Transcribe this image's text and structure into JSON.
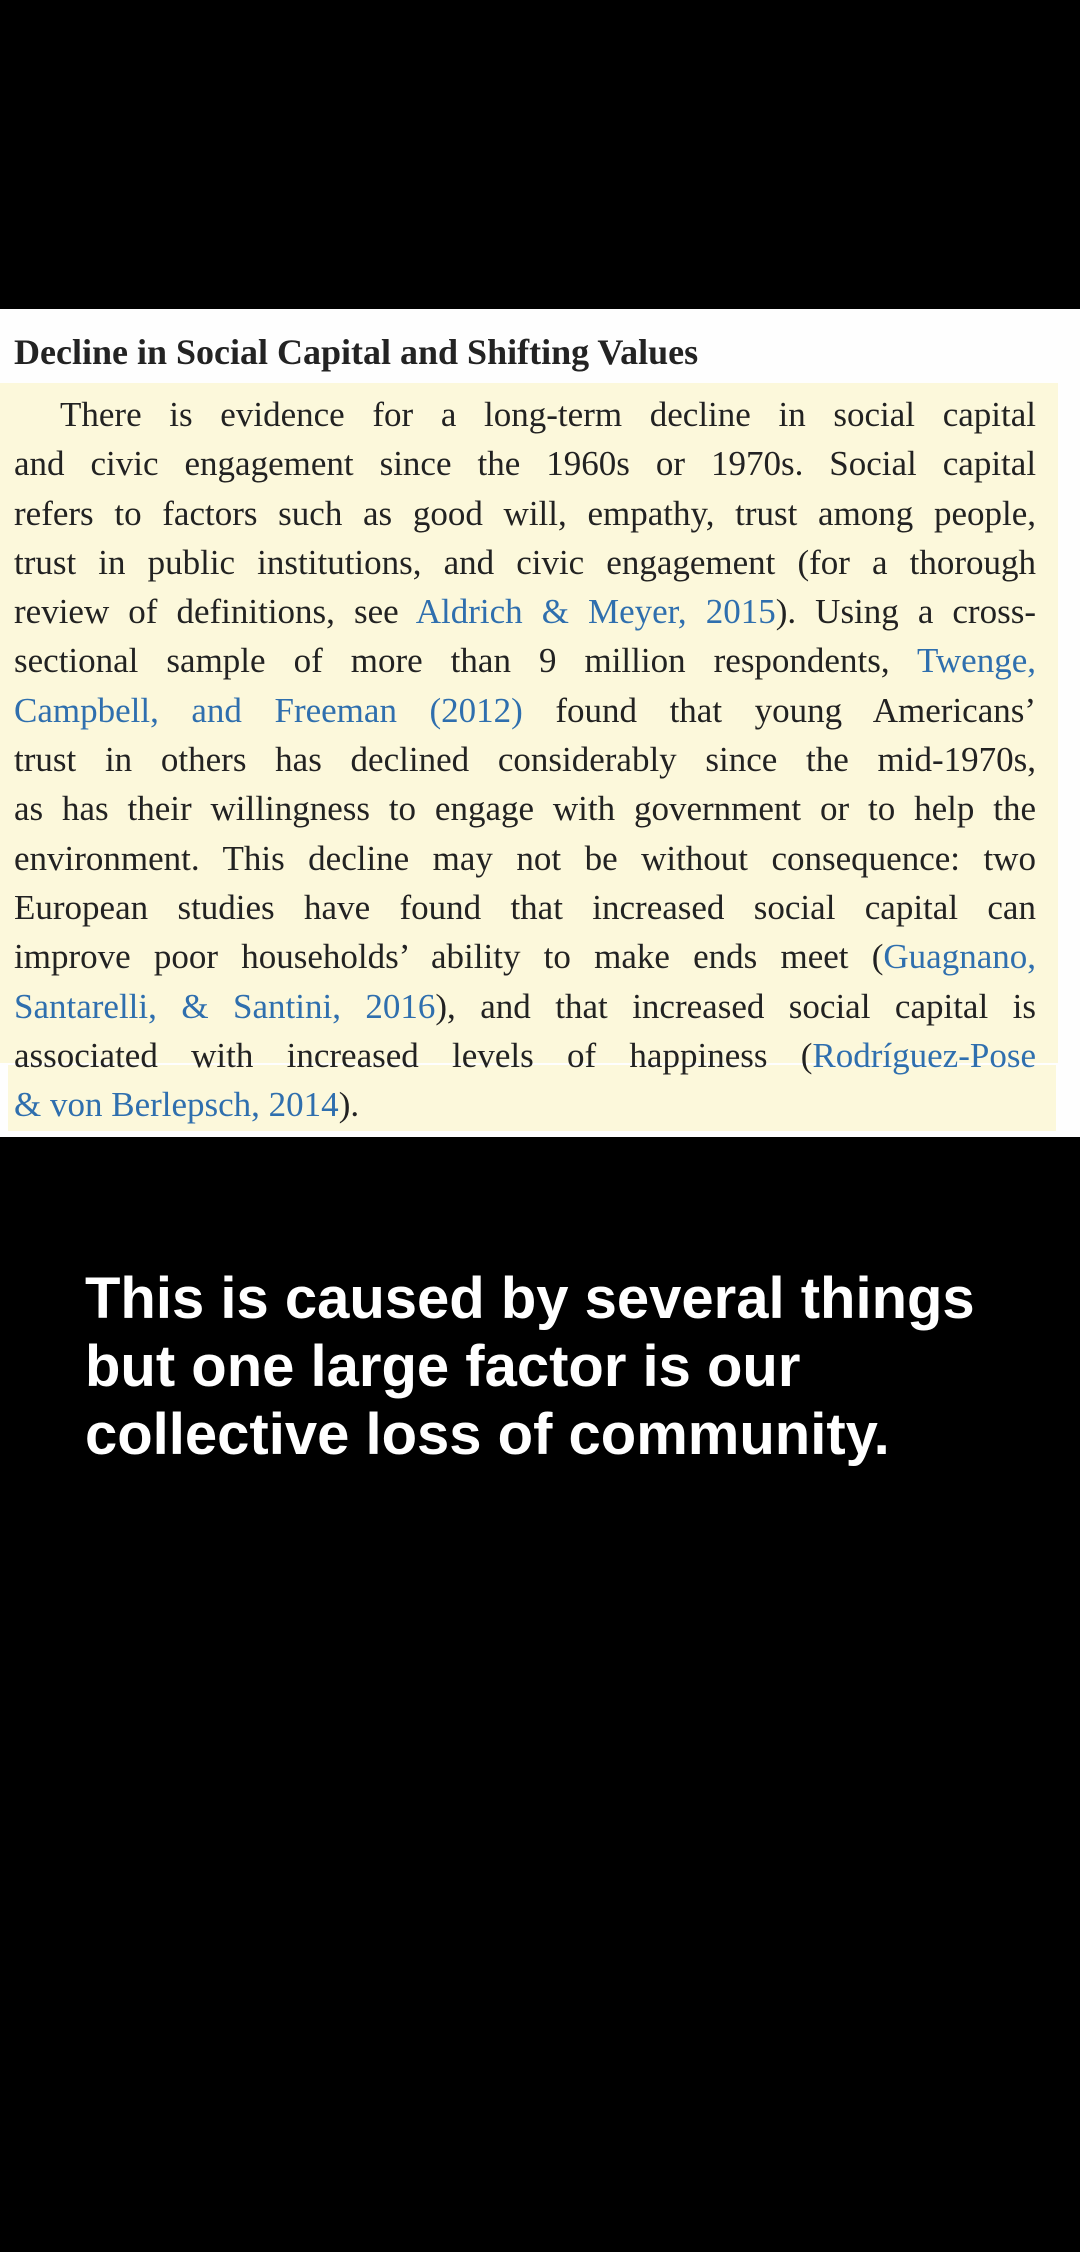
{
  "excerpt": {
    "heading": "Decline in Social Capital and Shifting Values",
    "lines": [
      {
        "indent": true,
        "parts": [
          {
            "t": "There is evidence for a long-term decline in social capital"
          }
        ]
      },
      {
        "parts": [
          {
            "t": "and civic engagement since the 1960s or 1970s. Social capital"
          }
        ]
      },
      {
        "parts": [
          {
            "t": "refers to factors such as good will, empathy, trust among people,"
          }
        ]
      },
      {
        "parts": [
          {
            "t": "trust in public institutions, and civic engagement (for a thorough"
          }
        ]
      },
      {
        "parts": [
          {
            "t": "review of definitions, see "
          },
          {
            "t": "Aldrich & Meyer, 2015",
            "cite": true
          },
          {
            "t": "). Using a cross-"
          }
        ]
      },
      {
        "parts": [
          {
            "t": "sectional sample of more than 9 million respondents, "
          },
          {
            "t": "Twenge,",
            "cite": true
          }
        ]
      },
      {
        "parts": [
          {
            "t": "Campbell, and Freeman (2012)",
            "cite": true
          },
          {
            "t": " found that young Americans’"
          }
        ]
      },
      {
        "parts": [
          {
            "t": "trust in others has declined considerably since the mid-1970s,"
          }
        ]
      },
      {
        "parts": [
          {
            "t": "as has their willingness to engage with government or to help the"
          }
        ]
      },
      {
        "parts": [
          {
            "t": "environment. This decline may not be without consequence: two"
          }
        ]
      },
      {
        "parts": [
          {
            "t": "European studies have found that increased social capital can"
          }
        ]
      },
      {
        "parts": [
          {
            "t": "improve poor households’ ability to make ends meet ("
          },
          {
            "t": "Guagnano,",
            "cite": true
          }
        ]
      },
      {
        "parts": [
          {
            "t": "Santarelli, & Santini, 2016",
            "cite": true
          },
          {
            "t": "), and that increased social capital is"
          }
        ]
      },
      {
        "parts": [
          {
            "t": "associated with increased levels of happiness ("
          },
          {
            "t": "Rodríguez-Pose",
            "cite": true
          }
        ]
      },
      {
        "parts": [
          {
            "t": "& von Berlepsch, 2014",
            "cite": true
          },
          {
            "t": ")."
          }
        ]
      }
    ]
  },
  "caption": {
    "text": "This is caused by several things but one large factor is our collective loss of community."
  },
  "colors": {
    "background": "#000000",
    "page": "#fefefe",
    "highlight": "#fbf6cf",
    "citation": "#2f6fae",
    "caption_text": "#ffffff"
  }
}
